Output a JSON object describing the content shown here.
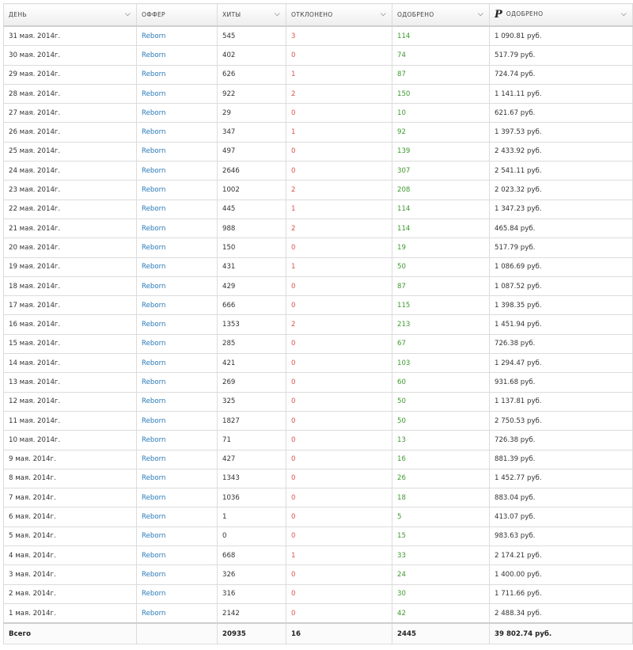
{
  "colors": {
    "offer_link": "#2a7ab9",
    "rejected": "#d9534f",
    "approved": "#3e9a2e"
  },
  "header": {
    "day": "ДЕНЬ",
    "offer": "ОФФЕР",
    "hits": "ХИТЫ",
    "rejected": "ОТКЛОНЕНО",
    "approved": "ОДОБРЕНО",
    "money_icon": "Р",
    "money_approved": "ОДОБРЕНО"
  },
  "rows": [
    {
      "day": "31 мая. 2014г.",
      "offer": "Reborn",
      "hits": "545",
      "rejected": "3",
      "approved": "114",
      "money": "1 090.81 руб."
    },
    {
      "day": "30 мая. 2014г.",
      "offer": "Reborn",
      "hits": "402",
      "rejected": "0",
      "approved": "74",
      "money": "517.79 руб."
    },
    {
      "day": "29 мая. 2014г.",
      "offer": "Reborn",
      "hits": "626",
      "rejected": "1",
      "approved": "87",
      "money": "724.74 руб."
    },
    {
      "day": "28 мая. 2014г.",
      "offer": "Reborn",
      "hits": "922",
      "rejected": "2",
      "approved": "150",
      "money": "1 141.11 руб."
    },
    {
      "day": "27 мая. 2014г.",
      "offer": "Reborn",
      "hits": "29",
      "rejected": "0",
      "approved": "10",
      "money": "621.67 руб."
    },
    {
      "day": "26 мая. 2014г.",
      "offer": "Reborn",
      "hits": "347",
      "rejected": "1",
      "approved": "92",
      "money": "1 397.53 руб."
    },
    {
      "day": "25 мая. 2014г.",
      "offer": "Reborn",
      "hits": "497",
      "rejected": "0",
      "approved": "139",
      "money": "2 433.92 руб."
    },
    {
      "day": "24 мая. 2014г.",
      "offer": "Reborn",
      "hits": "2646",
      "rejected": "0",
      "approved": "307",
      "money": "2 541.11 руб."
    },
    {
      "day": "23 мая. 2014г.",
      "offer": "Reborn",
      "hits": "1002",
      "rejected": "2",
      "approved": "208",
      "money": "2 023.32 руб."
    },
    {
      "day": "22 мая. 2014г.",
      "offer": "Reborn",
      "hits": "445",
      "rejected": "1",
      "approved": "114",
      "money": "1 347.23 руб."
    },
    {
      "day": "21 мая. 2014г.",
      "offer": "Reborn",
      "hits": "988",
      "rejected": "2",
      "approved": "114",
      "money": "465.84 руб."
    },
    {
      "day": "20 мая. 2014г.",
      "offer": "Reborn",
      "hits": "150",
      "rejected": "0",
      "approved": "19",
      "money": "517.79 руб."
    },
    {
      "day": "19 мая. 2014г.",
      "offer": "Reborn",
      "hits": "431",
      "rejected": "1",
      "approved": "50",
      "money": "1 086.69 руб."
    },
    {
      "day": "18 мая. 2014г.",
      "offer": "Reborn",
      "hits": "429",
      "rejected": "0",
      "approved": "87",
      "money": "1 087.52 руб."
    },
    {
      "day": "17 мая. 2014г.",
      "offer": "Reborn",
      "hits": "666",
      "rejected": "0",
      "approved": "115",
      "money": "1 398.35 руб."
    },
    {
      "day": "16 мая. 2014г.",
      "offer": "Reborn",
      "hits": "1353",
      "rejected": "2",
      "approved": "213",
      "money": "1 451.94 руб."
    },
    {
      "day": "15 мая. 2014г.",
      "offer": "Reborn",
      "hits": "285",
      "rejected": "0",
      "approved": "67",
      "money": "726.38 руб."
    },
    {
      "day": "14 мая. 2014г.",
      "offer": "Reborn",
      "hits": "421",
      "rejected": "0",
      "approved": "103",
      "money": "1 294.47 руб."
    },
    {
      "day": "13 мая. 2014г.",
      "offer": "Reborn",
      "hits": "269",
      "rejected": "0",
      "approved": "60",
      "money": "931.68 руб."
    },
    {
      "day": "12 мая. 2014г.",
      "offer": "Reborn",
      "hits": "325",
      "rejected": "0",
      "approved": "50",
      "money": "1 137.81 руб."
    },
    {
      "day": "11 мая. 2014г.",
      "offer": "Reborn",
      "hits": "1827",
      "rejected": "0",
      "approved": "50",
      "money": "2 750.53 руб."
    },
    {
      "day": "10 мая. 2014г.",
      "offer": "Reborn",
      "hits": "71",
      "rejected": "0",
      "approved": "13",
      "money": "726.38 руб."
    },
    {
      "day": "9 мая. 2014г.",
      "offer": "Reborn",
      "hits": "427",
      "rejected": "0",
      "approved": "16",
      "money": "881.39 руб."
    },
    {
      "day": "8 мая. 2014г.",
      "offer": "Reborn",
      "hits": "1343",
      "rejected": "0",
      "approved": "26",
      "money": "1 452.77 руб."
    },
    {
      "day": "7 мая. 2014г.",
      "offer": "Reborn",
      "hits": "1036",
      "rejected": "0",
      "approved": "18",
      "money": "883.04 руб."
    },
    {
      "day": "6 мая. 2014г.",
      "offer": "Reborn",
      "hits": "1",
      "rejected": "0",
      "approved": "5",
      "money": "413.07 руб."
    },
    {
      "day": "5 мая. 2014г.",
      "offer": "Reborn",
      "hits": "0",
      "rejected": "0",
      "approved": "15",
      "money": "983.63 руб."
    },
    {
      "day": "4 мая. 2014г.",
      "offer": "Reborn",
      "hits": "668",
      "rejected": "1",
      "approved": "33",
      "money": "2 174.21 руб."
    },
    {
      "day": "3 мая. 2014г.",
      "offer": "Reborn",
      "hits": "326",
      "rejected": "0",
      "approved": "24",
      "money": "1 400.00 руб."
    },
    {
      "day": "2 мая. 2014г.",
      "offer": "Reborn",
      "hits": "316",
      "rejected": "0",
      "approved": "30",
      "money": "1 711.66 руб."
    },
    {
      "day": "1 мая. 2014г.",
      "offer": "Reborn",
      "hits": "2142",
      "rejected": "0",
      "approved": "42",
      "money": "2 488.34 руб."
    }
  ],
  "totals": {
    "label": "Всего",
    "offer": "",
    "hits": "20935",
    "rejected": "16",
    "approved": "2445",
    "money": "39 802.74 руб."
  }
}
